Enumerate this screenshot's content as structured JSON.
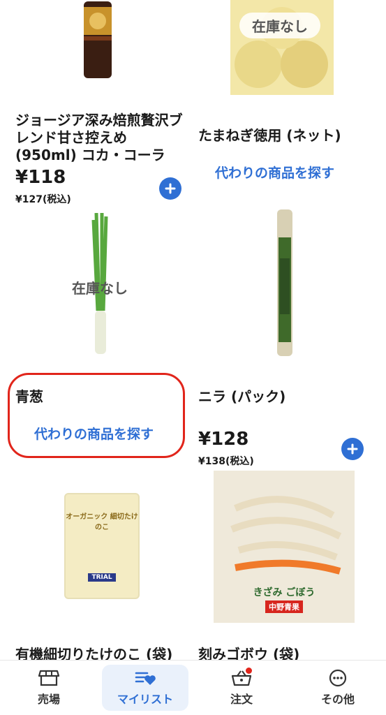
{
  "products": [
    {
      "name": "ジョージア深み焙煎贅沢ブレンド甘さ控えめ(950ml) コカ・コーラ",
      "price": "¥118",
      "tax_price": "¥127(税込)",
      "image": "coffee-bottle",
      "in_stock": true
    },
    {
      "name": "たまねぎ徳用 (ネット)",
      "out_of_stock_label": "在庫なし",
      "alternative_label": "代わりの商品を探す",
      "image": "onions-net",
      "in_stock": false
    },
    {
      "name": "青葱",
      "out_of_stock_label": "在庫なし",
      "alternative_label": "代わりの商品を探す",
      "image": "green-onion",
      "in_stock": false,
      "highlighted": true
    },
    {
      "name": "ニラ (パック)",
      "price": "¥128",
      "tax_price": "¥138(税込)",
      "image": "chives-pack",
      "in_stock": true
    },
    {
      "name": "有機細切りたけのこ (袋)",
      "image": "bamboo-shoots-bag",
      "package_text": "オーガニック 細切たけのこ",
      "package_brand": "TRIAL"
    },
    {
      "name": "刻みゴボウ (袋)",
      "image": "burdock-bag",
      "package_text": "きざみ ごぼう",
      "package_brand": "中野青果"
    }
  ],
  "tabbar": {
    "items": [
      {
        "label": "売場",
        "icon": "store-icon",
        "active": false
      },
      {
        "label": "マイリスト",
        "icon": "mylist-icon",
        "active": true
      },
      {
        "label": "注文",
        "icon": "basket-icon",
        "active": false,
        "badge": true
      },
      {
        "label": "その他",
        "icon": "more-icon",
        "active": false
      }
    ]
  },
  "colors": {
    "accent": "#2f6fd4",
    "highlight": "#e1251b",
    "out_of_stock_text": "#555555"
  }
}
